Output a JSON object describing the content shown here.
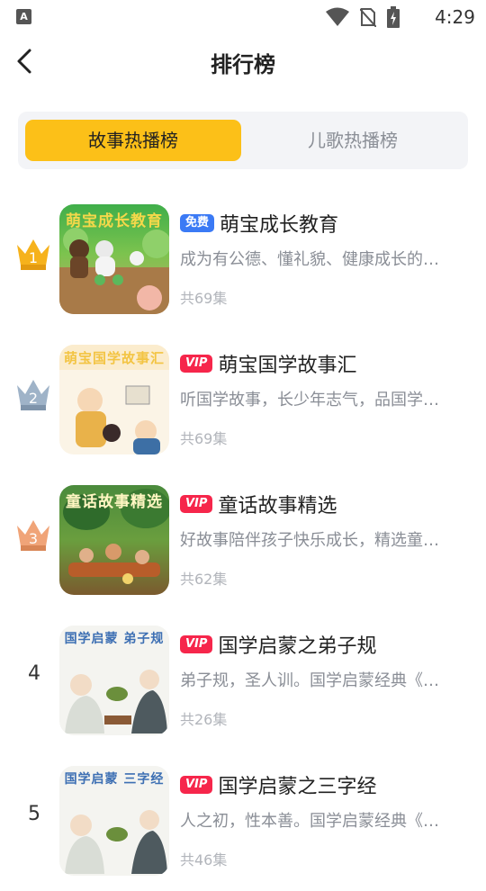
{
  "status_bar": {
    "time": "4:29",
    "app_icon_letter": "A"
  },
  "header": {
    "title": "排行榜"
  },
  "tabs": [
    {
      "label": "故事热播榜",
      "active": true
    },
    {
      "label": "儿歌热播榜",
      "active": false
    }
  ],
  "colors": {
    "accent": "#fcc018",
    "vip": "#f6264b",
    "free": "#3b7af5"
  },
  "items": [
    {
      "rank": "1",
      "badge": "免费",
      "badge_type": "free",
      "title": "萌宝成长教育",
      "description": "成为有公德、懂礼貌、健康成长的…",
      "count": "共69集",
      "cover_text": "萌宝成长教育"
    },
    {
      "rank": "2",
      "badge": "VIP",
      "badge_type": "vip",
      "title": "萌宝国学故事汇",
      "description": "听国学故事，长少年志气，品国学…",
      "count": "共69集",
      "cover_text": "萌宝国学故事汇"
    },
    {
      "rank": "3",
      "badge": "VIP",
      "badge_type": "vip",
      "title": "童话故事精选",
      "description": "好故事陪伴孩子快乐成长，精选童…",
      "count": "共62集",
      "cover_text": "童话故事精选"
    },
    {
      "rank": "4",
      "badge": "VIP",
      "badge_type": "vip",
      "title": "国学启蒙之弟子规",
      "description": "弟子规，圣人训。国学启蒙经典《…",
      "count": "共26集",
      "cover_text": "国学启蒙 弟子规"
    },
    {
      "rank": "5",
      "badge": "VIP",
      "badge_type": "vip",
      "title": "国学启蒙之三字经",
      "description": "人之初，性本善。国学启蒙经典《…",
      "count": "共46集",
      "cover_text": "国学启蒙 三字经"
    }
  ]
}
